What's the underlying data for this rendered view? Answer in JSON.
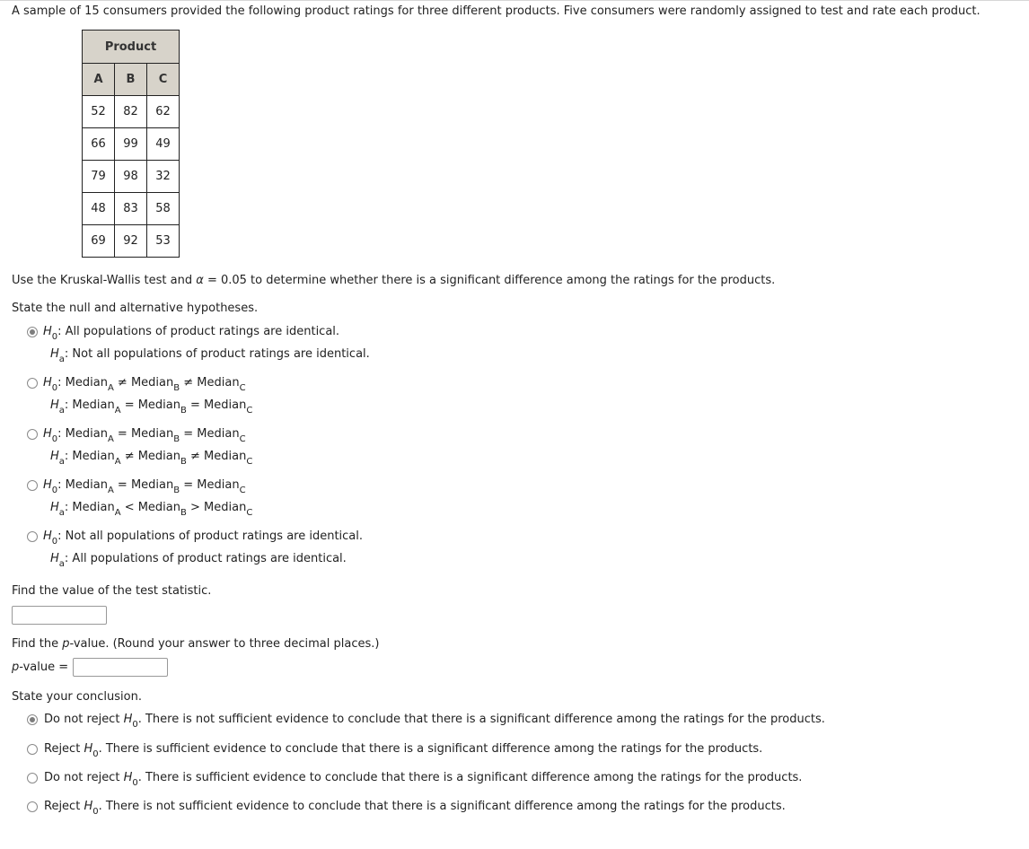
{
  "intro": "A sample of 15 consumers provided the following product ratings for three different products. Five consumers were randomly assigned to test and rate each product.",
  "table": {
    "group_header": "Product",
    "columns": [
      "A",
      "B",
      "C"
    ],
    "rows": [
      [
        "52",
        "82",
        "62"
      ],
      [
        "66",
        "99",
        "49"
      ],
      [
        "79",
        "98",
        "32"
      ],
      [
        "48",
        "83",
        "58"
      ],
      [
        "69",
        "92",
        "53"
      ]
    ]
  },
  "instruction": {
    "pre": "Use the Kruskal-Wallis test and ",
    "alpha_symbol": "α",
    "post": " = 0.05 to determine whether there is a significant difference among the ratings for the products."
  },
  "hypotheses": {
    "prompt": "State the null and alternative hypotheses.",
    "H": "H",
    "sub0": "0",
    "suba": "a",
    "options": [
      {
        "selected": true,
        "h0": ": All populations of product ratings are identical.",
        "ha": ": Not all populations of product ratings are identical."
      },
      {
        "selected": false,
        "h0_parts": [
          ": Median",
          "A",
          " ≠ Median",
          "B",
          " ≠ Median",
          "C"
        ],
        "ha_parts": [
          ": Median",
          "A",
          " = Median",
          "B",
          " = Median",
          "C"
        ]
      },
      {
        "selected": false,
        "h0_parts": [
          ": Median",
          "A",
          " = Median",
          "B",
          " = Median",
          "C"
        ],
        "ha_parts": [
          ": Median",
          "A",
          " ≠ Median",
          "B",
          " ≠ Median",
          "C"
        ]
      },
      {
        "selected": false,
        "h0_parts": [
          ": Median",
          "A",
          " = Median",
          "B",
          " = Median",
          "C"
        ],
        "ha_parts": [
          ": Median",
          "A",
          " < Median",
          "B",
          " > Median",
          "C"
        ]
      },
      {
        "selected": false,
        "h0": ": Not all populations of product ratings are identical.",
        "ha": ": All populations of product ratings are identical."
      }
    ]
  },
  "test_statistic": {
    "prompt": "Find the value of the test statistic.",
    "value": ""
  },
  "p_value": {
    "prompt_pre": "Find the ",
    "p": "p",
    "prompt_post": "-value. (Round your answer to three decimal places.)",
    "label_post": "-value =",
    "value": ""
  },
  "conclusion": {
    "prompt": "State your conclusion.",
    "options": [
      {
        "selected": true,
        "pre": "Do not reject ",
        "post": ". There is not sufficient evidence to conclude that there is a significant difference among the ratings for the products."
      },
      {
        "selected": false,
        "pre": "Reject ",
        "post": ". There is sufficient evidence to conclude that there is a significant difference among the ratings for the products."
      },
      {
        "selected": false,
        "pre": "Do not reject ",
        "post": ". There is sufficient evidence to conclude that there is a significant difference among the ratings for the products."
      },
      {
        "selected": false,
        "pre": "Reject ",
        "post": ". There is not sufficient evidence to conclude that there is a significant difference among the ratings for the products."
      }
    ]
  }
}
